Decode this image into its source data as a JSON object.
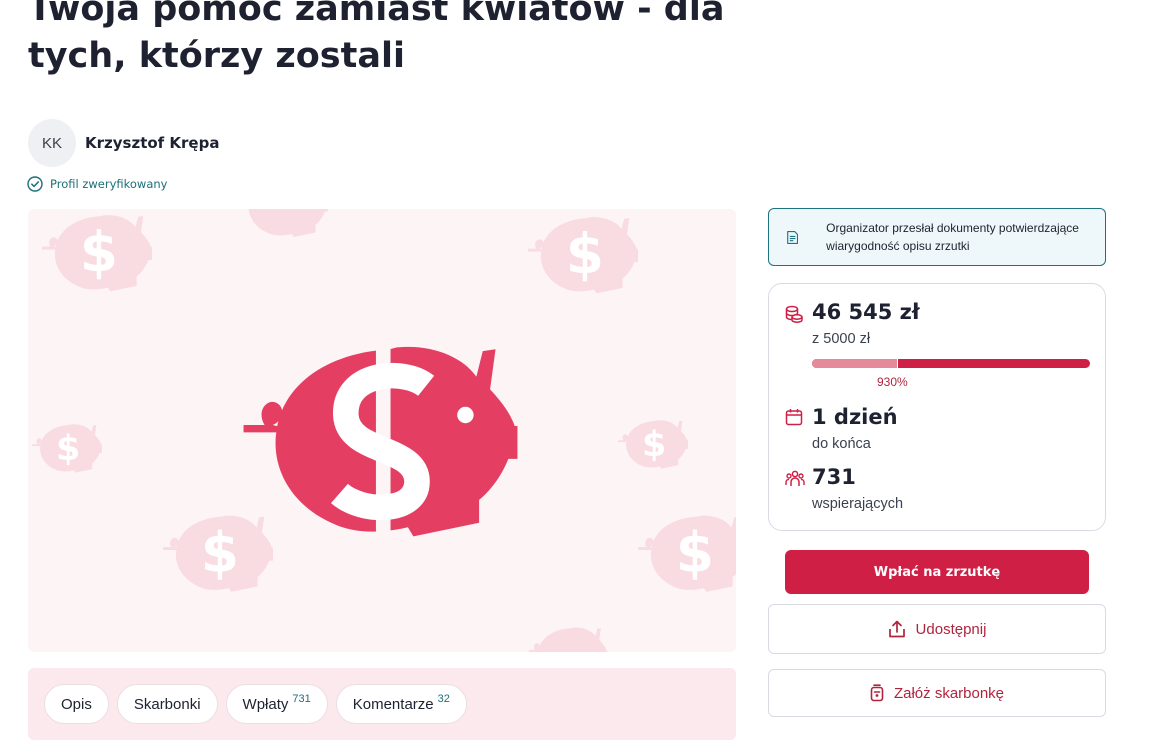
{
  "campaign": {
    "title": "Twoja pomoc zamiast kwiatów - dla tych, którzy zostali"
  },
  "author": {
    "initials": "KK",
    "name": "Krzysztof Krępa",
    "verified_label": "Profil zweryfikowany"
  },
  "notice": {
    "text": "Organizator przesłał dokumenty potwierdzające wiarygodność opisu zrzutki"
  },
  "stats": {
    "amount": "46 545 zł",
    "goal": "z 5000 zł",
    "progress_percent_label": "930%",
    "progress_goal_fraction": 0.31,
    "days_left_value": "1 dzień",
    "days_left_label": "do końca",
    "supporters_value": "731",
    "supporters_label": "wspierających"
  },
  "actions": {
    "donate_label": "Wpłać na zrzutkę",
    "share_label": "Udostępnij",
    "piggybank_label": "Załóż skarbonkę"
  },
  "tabs": [
    {
      "label": "Opis",
      "count": ""
    },
    {
      "label": "Skarbonki",
      "count": ""
    },
    {
      "label": "Wpłaty",
      "count": "731"
    },
    {
      "label": "Komentarze",
      "count": "32"
    }
  ],
  "colors": {
    "accent": "#cf1f45",
    "pig": "#e43f63",
    "pig_light": "#f9dbe2",
    "teal": "#1c7480",
    "hero_bg": "#fdf4f6"
  }
}
